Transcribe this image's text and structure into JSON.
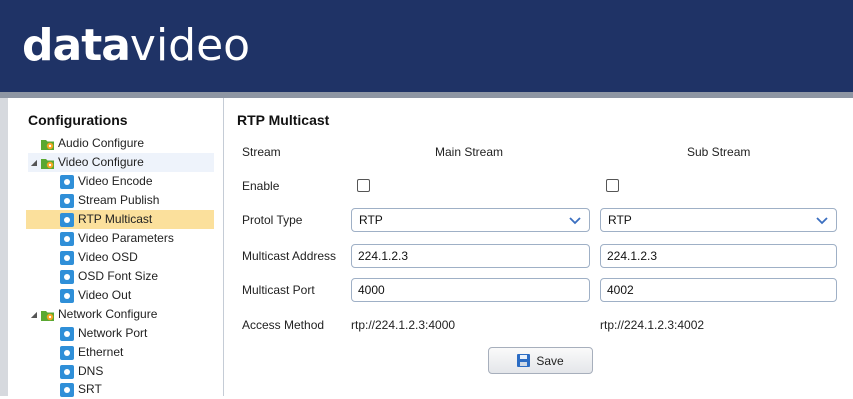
{
  "header": {
    "logo_bold": "data",
    "logo_light": "video"
  },
  "sidebar": {
    "title": "Configurations",
    "items": [
      {
        "label": "Audio Configure",
        "icon": "folder-gear-icon"
      },
      {
        "label": "Video Configure",
        "icon": "folder-gear-icon",
        "expanded": true
      },
      {
        "label": "Video Encode",
        "icon": "gear-icon"
      },
      {
        "label": "Stream Publish",
        "icon": "gear-icon"
      },
      {
        "label": "RTP Multicast",
        "icon": "gear-icon",
        "selected": true
      },
      {
        "label": "Video Parameters",
        "icon": "gear-icon"
      },
      {
        "label": "Video OSD",
        "icon": "gear-icon"
      },
      {
        "label": "OSD Font Size",
        "icon": "gear-icon"
      },
      {
        "label": "Video Out",
        "icon": "gear-icon"
      },
      {
        "label": "Network Configure",
        "icon": "folder-gear-icon",
        "expanded": true
      },
      {
        "label": "Network Port",
        "icon": "gear-icon"
      },
      {
        "label": "Ethernet",
        "icon": "gear-icon"
      },
      {
        "label": "DNS",
        "icon": "gear-icon"
      },
      {
        "label": "SRT",
        "icon": "gear-icon"
      }
    ]
  },
  "main": {
    "title": "RTP Multicast",
    "labels": {
      "stream": "Stream",
      "enable": "Enable",
      "protocol_type": "Protol Type",
      "multicast_address": "Multicast Address",
      "multicast_port": "Multicast Port",
      "access_method": "Access Method"
    },
    "main_stream": {
      "header": "Main Stream",
      "enabled": false,
      "protocol": "RTP",
      "address": "224.1.2.3",
      "port": "4000",
      "access": "rtp://224.1.2.3:4000"
    },
    "sub_stream": {
      "header": "Sub Stream",
      "enabled": false,
      "protocol": "RTP",
      "address": "224.1.2.3",
      "port": "4002",
      "access": "rtp://224.1.2.3:4002"
    },
    "save_label": "Save"
  },
  "colors": {
    "header_bg": "#1f3366",
    "selected_bg": "#fbe09c",
    "icon_blue": "#2f8fd8",
    "folder_green": "#5aa832"
  }
}
